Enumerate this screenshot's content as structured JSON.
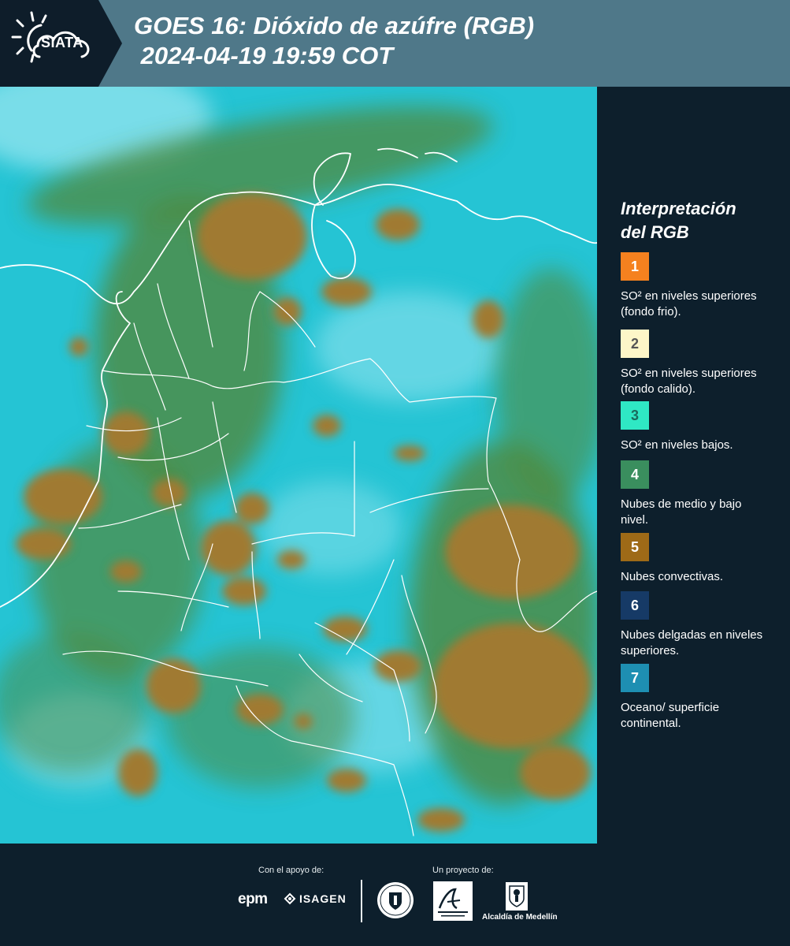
{
  "header": {
    "logo_text": "SIATA",
    "title_line1": "GOES 16: Dióxido de azúfre (RGB)",
    "title_line2": " 2024-04-19 19:59 COT"
  },
  "map": {
    "palette": {
      "cyan": "#25c4d4",
      "light_cyan": "#8ee3ee",
      "green": "#4f8a3e",
      "brown": "#a07a33",
      "border": "#ffffff"
    }
  },
  "legend": {
    "title_line1": "Interpretación",
    "title_line2": "del RGB",
    "items": [
      {
        "number": "1",
        "color": "#f5811f",
        "text_color": "#ffffff",
        "label": "SO² en niveles superiores (fondo frio)."
      },
      {
        "number": "2",
        "color": "#fdf6c8",
        "text_color": "#555555",
        "label": "SO² en niveles superiores (fondo calido)."
      },
      {
        "number": "3",
        "color": "#2fe8c4",
        "text_color": "#1a6a5c",
        "label": "SO² en niveles bajos."
      },
      {
        "number": "4",
        "color": "#3a8e5e",
        "text_color": "#ffffff",
        "label": "Nubes de medio y bajo nivel."
      },
      {
        "number": "5",
        "color": "#9e6a17",
        "text_color": "#ffffff",
        "label": "Nubes convectivas."
      },
      {
        "number": "6",
        "color": "#163a66",
        "text_color": "#ffffff",
        "label": "Nubes delgadas en niveles superiores."
      },
      {
        "number": "7",
        "color": "#1e8fb2",
        "text_color": "#ffffff",
        "label": "Oceano/ superficie continental."
      }
    ]
  },
  "footer": {
    "support_label": "Con el apoyo de:",
    "project_label": "Un proyecto de:",
    "epm": "epm",
    "isagen": "ISAGEN",
    "alcaldia": "Alcaldía de Medellín"
  }
}
